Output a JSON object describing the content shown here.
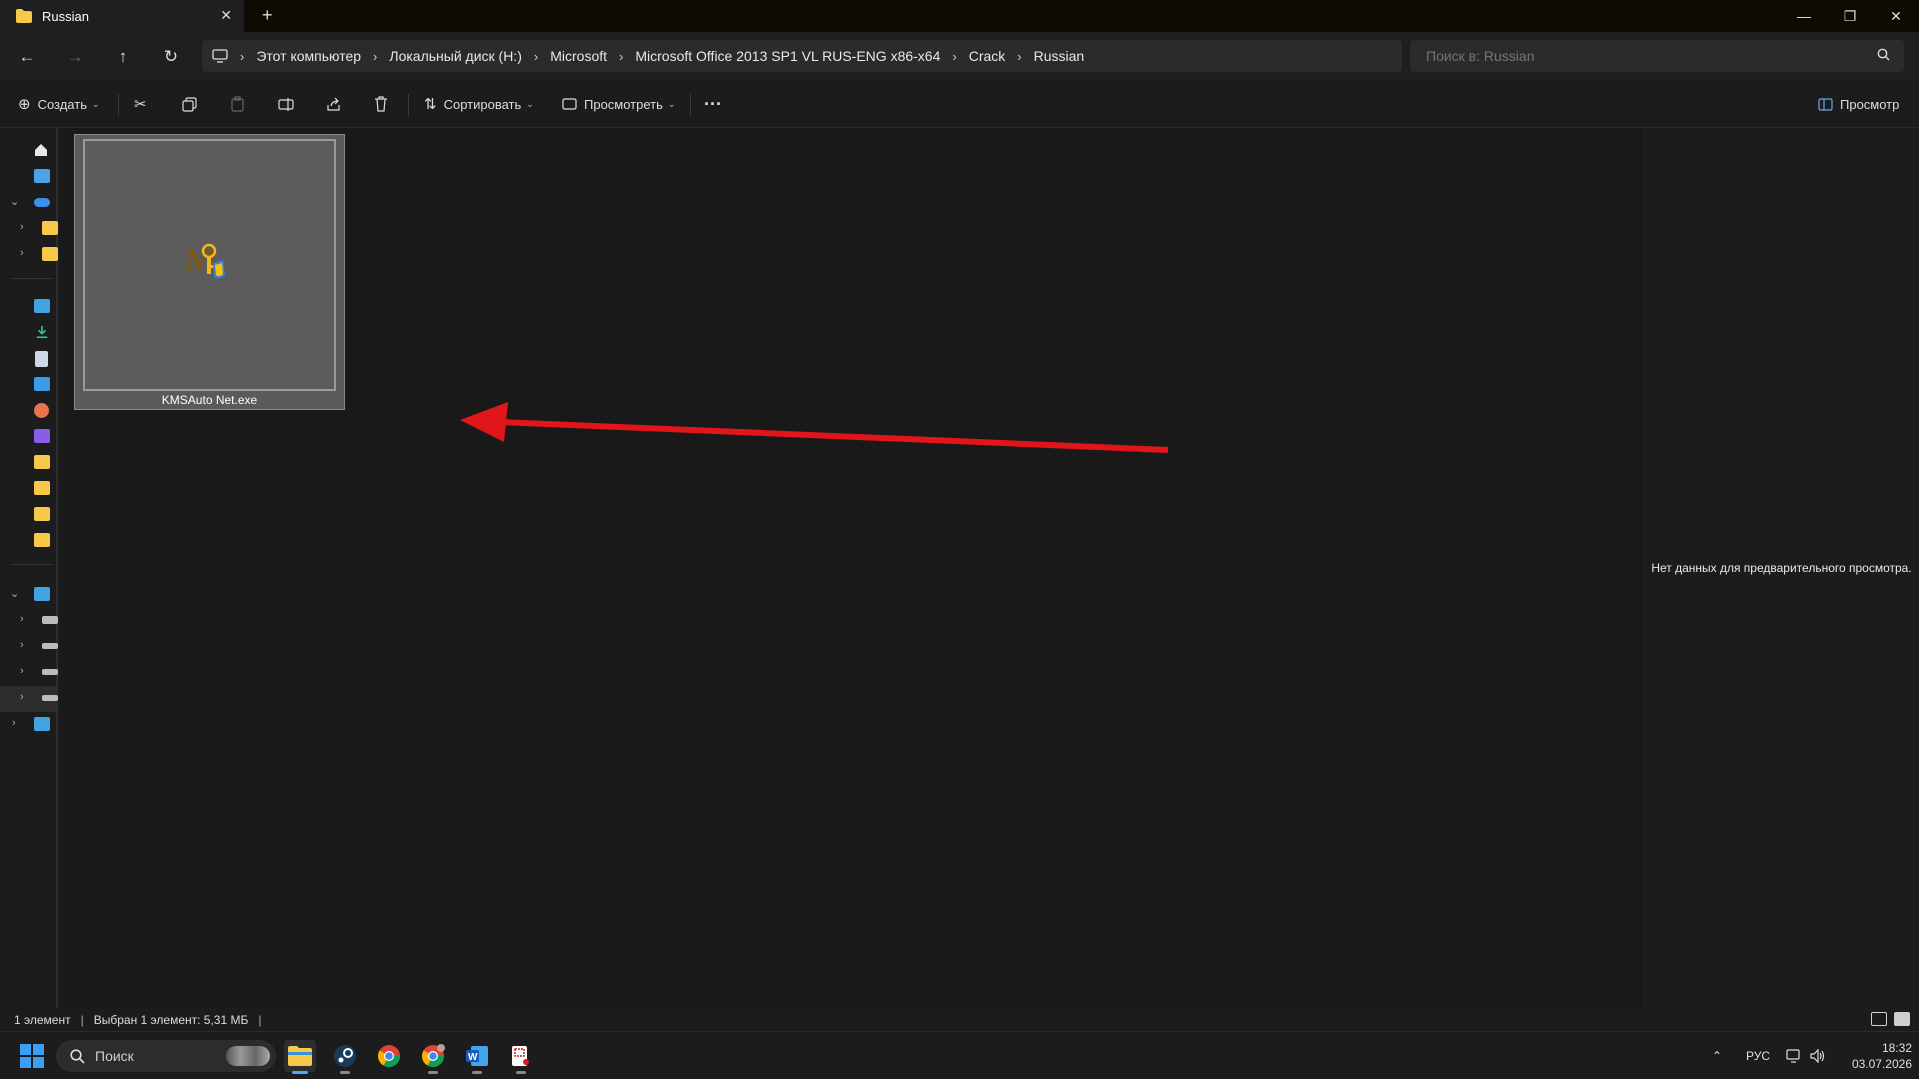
{
  "window": {
    "tab_title": "Russian",
    "tab_close": "✕",
    "new_tab": "+",
    "controls": [
      "—",
      "❐",
      "✕"
    ]
  },
  "nav": {
    "back": "←",
    "forward": "→",
    "up": "↑",
    "refresh": "↻",
    "breadcrumbs": [
      "Этот компьютер",
      "Локальный диск (H:)",
      "Microsoft",
      "Microsoft Office 2013 SP1 VL RUS-ENG x86-x64",
      "Crack",
      "Russian"
    ],
    "search_placeholder": "Поиск в: Russian"
  },
  "commands": {
    "create": "Создать",
    "sort": "Сортировать",
    "view": "Просмотреть",
    "more": "···",
    "preview_toggle": "Просмотр"
  },
  "file": {
    "name": "KMSAuto Net.exe",
    "selected": true
  },
  "preview": {
    "message": "Нет данных для предварительного просмотра."
  },
  "status": {
    "count": "1 элемент",
    "selection": "Выбран 1 элемент: 5,31 МБ"
  },
  "taskbar": {
    "search_label": "Поиск",
    "language": "РУС",
    "time": "18:32",
    "date": "03.07.2026"
  },
  "colors": {
    "accent": "#5aa5f0",
    "folder": "#f7c948",
    "arrow": "#e0161b"
  }
}
